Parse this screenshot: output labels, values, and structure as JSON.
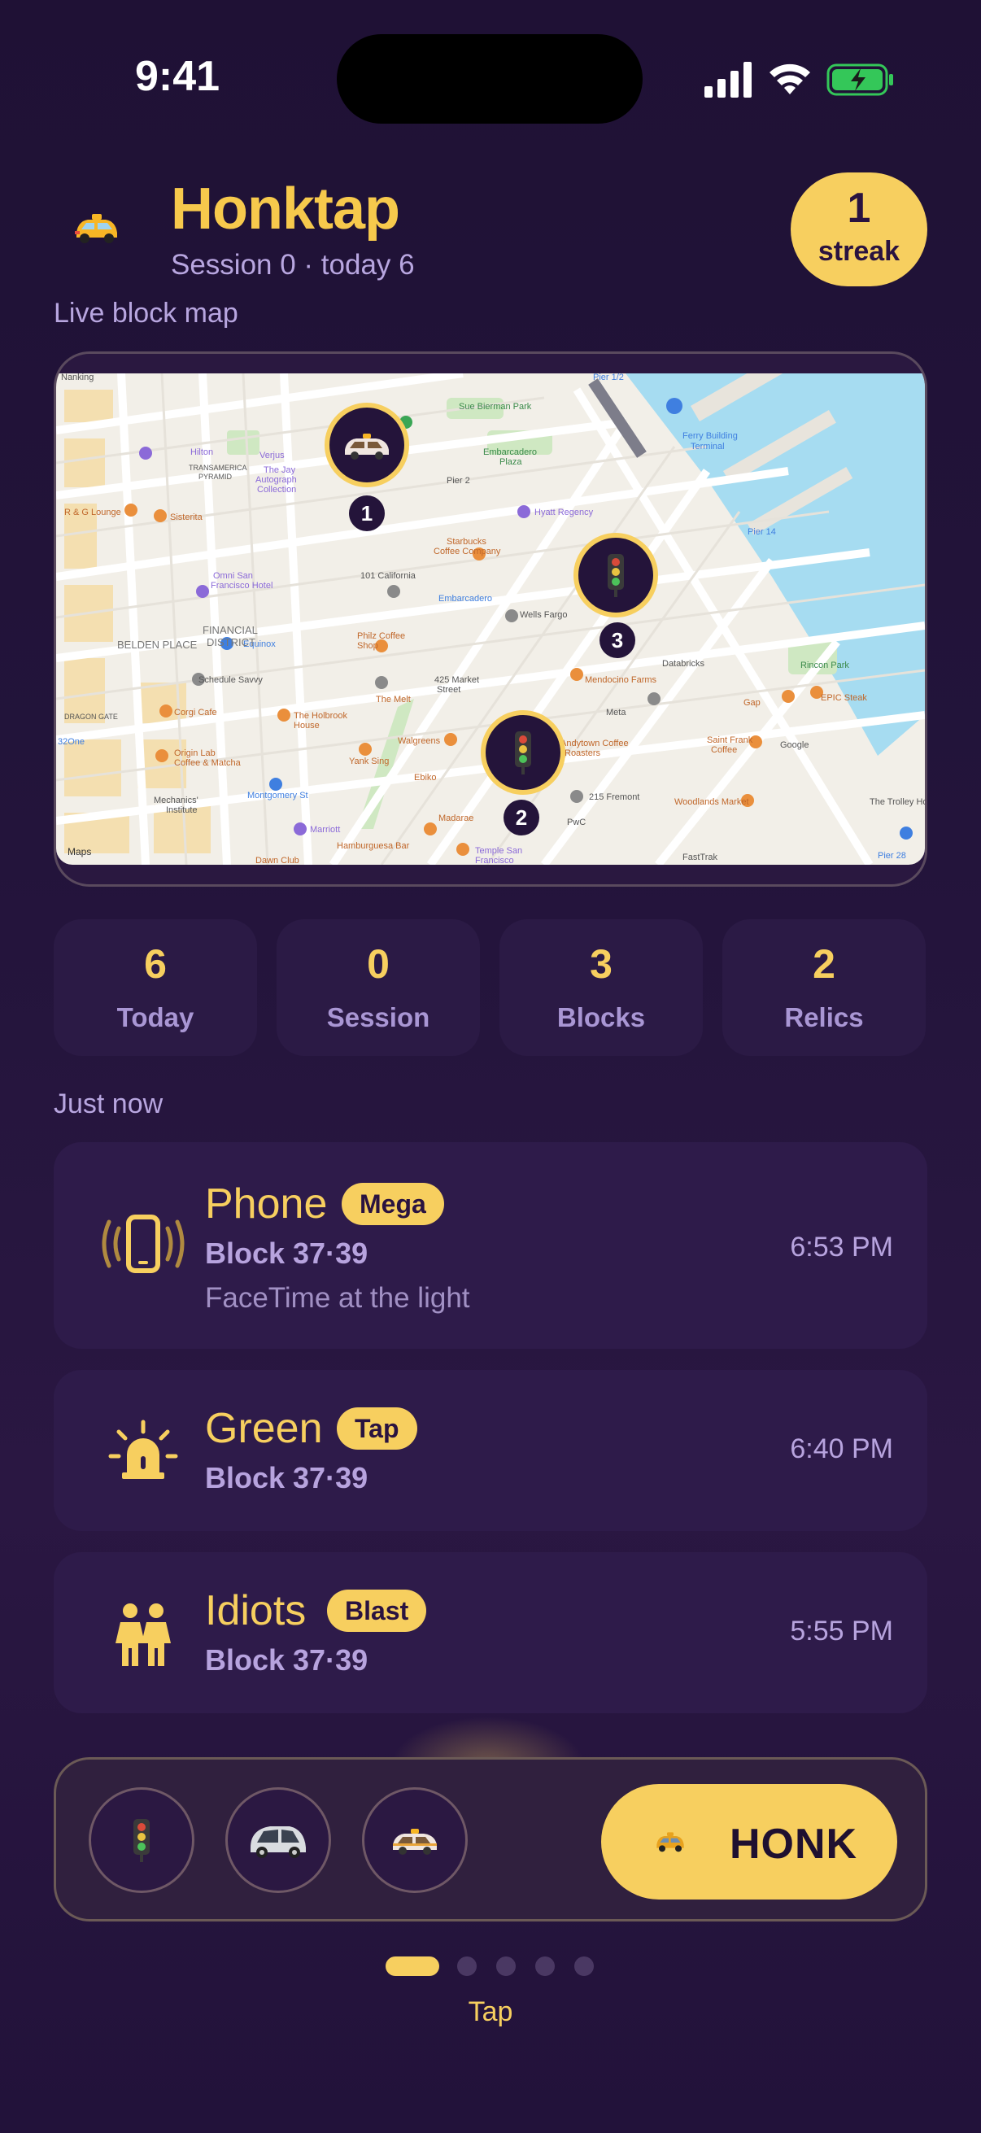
{
  "status": {
    "time": "9:41"
  },
  "header": {
    "title": "Honktap",
    "subtitle": "Session 0 · today 6",
    "streak": {
      "value": "1",
      "label": "streak"
    }
  },
  "map": {
    "section_label": "Live block map",
    "pins": [
      {
        "label": "1",
        "icon": "car-icon"
      },
      {
        "label": "3",
        "icon": "traffic-light-icon"
      },
      {
        "label": "2",
        "icon": "traffic-light-icon"
      }
    ],
    "places": [
      "Pier 1/2",
      "Sue Bierman Park",
      "Ferry Building Terminal",
      "Embarcadero Plaza",
      "Hilton",
      "TRANSAMERICA PYRAMID",
      "The Jay Autograph Collection",
      "R & G Lounge",
      "Sisterita",
      "Hyatt Regency",
      "Starbucks Coffee Company",
      "Embarcadero",
      "101 California",
      "Wells Fargo",
      "Omni San Francisco Hotel",
      "Equinox",
      "BELDEN PLACE",
      "FINANCIAL DISTRICT",
      "Philz Coffee",
      "The Melt",
      "425 Market Street",
      "Mendocino Farms",
      "Databricks",
      "Rincon Park",
      "Schedule Savvy",
      "Corgi Cafe",
      "The Holbrook House",
      "Meta",
      "Gap",
      "EPIC Steak",
      "Walgreens",
      "Yank Sing",
      "Andytown Coffee Roasters",
      "Saint Frank Coffee",
      "Google",
      "Origin Lab Coffee & Matcha",
      "DRAGON GATE",
      "320ne",
      "Montgomery St",
      "Ebiko",
      "215 Fremont",
      "Woodlands Market",
      "Mechanics' Institute",
      "Marriott",
      "Hamburguesa Bar",
      "Madarae",
      "PwC",
      "Temple San Francisco",
      "FastTrak",
      "The Trolley House",
      "Pier 2",
      "Pier 14",
      "Pier 28",
      "Dawn Club",
      "Verjus",
      "Nanking",
      "Maps"
    ]
  },
  "stats": [
    {
      "value": "6",
      "label": "Today"
    },
    {
      "value": "0",
      "label": "Session"
    },
    {
      "value": "3",
      "label": "Blocks"
    },
    {
      "value": "2",
      "label": "Relics"
    }
  ],
  "feed": {
    "section_label": "Just now",
    "items": [
      {
        "title": "Phone",
        "badge": "Mega",
        "block": "Block 37·39",
        "detail": "FaceTime at the light",
        "time": "6:53 PM",
        "icon": "phone-ringing-icon"
      },
      {
        "title": "Green",
        "badge": "Tap",
        "block": "Block 37·39",
        "detail": "",
        "time": "6:40 PM",
        "icon": "siren-icon"
      },
      {
        "title": "Idiots",
        "badge": "Blast",
        "block": "Block 37·39",
        "detail": "",
        "time": "5:55 PM",
        "icon": "two-people-icon"
      }
    ]
  },
  "actions": {
    "tools": [
      "traffic-light-icon",
      "smart-car-icon",
      "taxi-car-icon"
    ],
    "honk_label": "HONK"
  },
  "pager": {
    "label": "Tap",
    "count": 5,
    "active_index": 0
  },
  "colors": {
    "accent": "#f7cf5f",
    "background": "#23143b",
    "card": "#2e1b4a",
    "muted": "#b8a6e0"
  }
}
